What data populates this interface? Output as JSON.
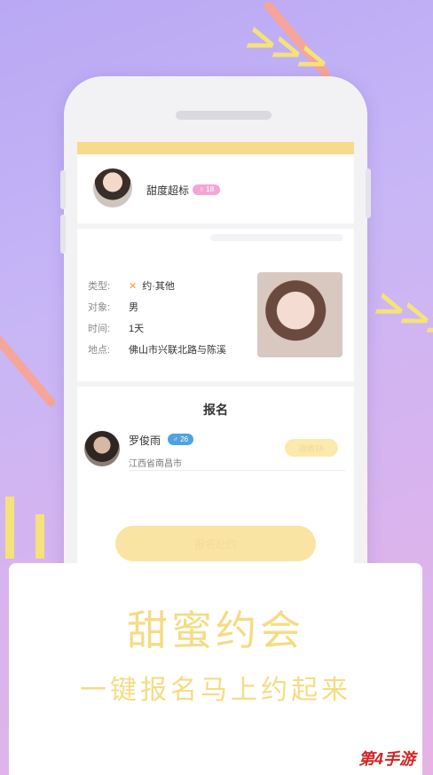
{
  "host": {
    "name": "甜度超标",
    "age": "18"
  },
  "info": {
    "rows": [
      {
        "label": "类型:",
        "value": "约·其他"
      },
      {
        "label": "对象:",
        "value": "男"
      },
      {
        "label": "时间:",
        "value": "1天"
      },
      {
        "label": "地点:",
        "value": "佛山市兴联北路与陈溪"
      }
    ]
  },
  "signup": {
    "title": "报名",
    "user": {
      "name": "罗俊雨",
      "age": "26",
      "gender_symbol": "♂",
      "location": "江西省南昌市",
      "button": "选他TA"
    }
  },
  "bottom_button": "报名赴约",
  "promo": {
    "headline": "甜蜜约会",
    "tagline": "一键报名马上约起来"
  },
  "logo": "第4手游",
  "colors": {
    "accent_yellow": "#f7da8a",
    "pink_badge": "#f3a6d6",
    "blue_badge": "#4fa3e0"
  }
}
